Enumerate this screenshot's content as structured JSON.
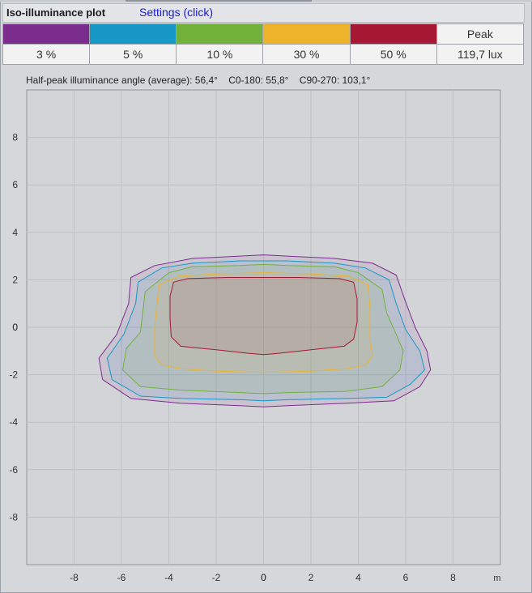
{
  "header": {
    "title": "Iso-illuminance plot",
    "settings_link": "Settings (click)"
  },
  "legend": {
    "levels": [
      {
        "label": "3 %",
        "color": "#7b2d8e"
      },
      {
        "label": "5 %",
        "color": "#1798c6"
      },
      {
        "label": "10 %",
        "color": "#72b23a"
      },
      {
        "label": "30 %",
        "color": "#efb22b"
      },
      {
        "label": "50 %",
        "color": "#a51733"
      }
    ],
    "peak_label": "Peak",
    "peak_value": "119,7 lux"
  },
  "half_peak_text": "Half-peak illuminance angle (average): 56,4°    C0-180: 55,8°    C90-270: 103,1°",
  "chart_data": {
    "type": "contour",
    "x_unit": "m",
    "xlim": [
      -10,
      10
    ],
    "ylim": [
      -10,
      10
    ],
    "x_ticks": [
      -8,
      -6,
      -4,
      -2,
      0,
      2,
      4,
      6,
      8
    ],
    "y_ticks": [
      8,
      6,
      4,
      2,
      0,
      -2,
      -4,
      -6,
      -8
    ],
    "grid": true,
    "series": [
      {
        "name": "3 %",
        "color": "#7b2d8e",
        "points": [
          [
            -5.6,
            2.1
          ],
          [
            -4.6,
            2.6
          ],
          [
            -3,
            2.9
          ],
          [
            -1,
            3.0
          ],
          [
            0,
            3.05
          ],
          [
            1,
            3.0
          ],
          [
            3,
            2.9
          ],
          [
            4.6,
            2.7
          ],
          [
            5.6,
            2.2
          ],
          [
            5.95,
            1.2
          ],
          [
            6.4,
            0.0
          ],
          [
            6.9,
            -1.0
          ],
          [
            7.05,
            -1.8
          ],
          [
            6.6,
            -2.5
          ],
          [
            5.5,
            -3.1
          ],
          [
            3.5,
            -3.2
          ],
          [
            1,
            -3.3
          ],
          [
            0,
            -3.35
          ],
          [
            -1,
            -3.3
          ],
          [
            -3.5,
            -3.2
          ],
          [
            -5.6,
            -3.0
          ],
          [
            -6.8,
            -2.2
          ],
          [
            -6.95,
            -1.3
          ],
          [
            -6.2,
            -0.3
          ],
          [
            -5.7,
            1.0
          ]
        ]
      },
      {
        "name": "5 %",
        "color": "#1798c6",
        "points": [
          [
            -5.3,
            1.9
          ],
          [
            -4.3,
            2.5
          ],
          [
            -3,
            2.7
          ],
          [
            -1,
            2.8
          ],
          [
            0,
            2.8
          ],
          [
            1,
            2.8
          ],
          [
            3,
            2.7
          ],
          [
            4.3,
            2.5
          ],
          [
            5.3,
            2.0
          ],
          [
            5.6,
            1.0
          ],
          [
            6.0,
            -0.1
          ],
          [
            6.6,
            -1.0
          ],
          [
            6.8,
            -1.8
          ],
          [
            6.2,
            -2.4
          ],
          [
            5.2,
            -2.95
          ],
          [
            3.5,
            -3.0
          ],
          [
            1,
            -3.05
          ],
          [
            0,
            -3.1
          ],
          [
            -1,
            -3.05
          ],
          [
            -3.5,
            -3.0
          ],
          [
            -5.2,
            -2.9
          ],
          [
            -6.4,
            -2.2
          ],
          [
            -6.6,
            -1.3
          ],
          [
            -5.9,
            -0.3
          ],
          [
            -5.4,
            1.0
          ]
        ]
      },
      {
        "name": "10 %",
        "color": "#72b23a",
        "points": [
          [
            -5.0,
            1.5
          ],
          [
            -4.0,
            2.3
          ],
          [
            -3,
            2.55
          ],
          [
            -1,
            2.6
          ],
          [
            0,
            2.65
          ],
          [
            1,
            2.6
          ],
          [
            3,
            2.55
          ],
          [
            4.0,
            2.3
          ],
          [
            5.0,
            1.6
          ],
          [
            5.2,
            0.6
          ],
          [
            5.6,
            -0.3
          ],
          [
            5.9,
            -1.0
          ],
          [
            5.75,
            -1.8
          ],
          [
            5.0,
            -2.5
          ],
          [
            3.5,
            -2.7
          ],
          [
            1,
            -2.75
          ],
          [
            0,
            -2.8
          ],
          [
            -1,
            -2.75
          ],
          [
            -3.5,
            -2.65
          ],
          [
            -5.2,
            -2.5
          ],
          [
            -5.95,
            -1.8
          ],
          [
            -5.8,
            -0.9
          ],
          [
            -5.2,
            -0.2
          ]
        ]
      },
      {
        "name": "30 %",
        "color": "#efb22b",
        "points": [
          [
            -4.4,
            1.8
          ],
          [
            -3.6,
            2.15
          ],
          [
            -2,
            2.25
          ],
          [
            0,
            2.3
          ],
          [
            2,
            2.25
          ],
          [
            3.6,
            2.15
          ],
          [
            4.4,
            1.8
          ],
          [
            4.5,
            0.8
          ],
          [
            4.5,
            -0.5
          ],
          [
            4.6,
            -1.2
          ],
          [
            4.3,
            -1.6
          ],
          [
            3.5,
            -1.75
          ],
          [
            2,
            -1.85
          ],
          [
            0,
            -1.9
          ],
          [
            -2,
            -1.85
          ],
          [
            -3.5,
            -1.75
          ],
          [
            -4.3,
            -1.6
          ],
          [
            -4.6,
            -1.2
          ],
          [
            -4.6,
            0.0
          ],
          [
            -4.5,
            1.0
          ]
        ]
      },
      {
        "name": "50 %",
        "color": "#a51733",
        "points": [
          [
            -3.8,
            1.9
          ],
          [
            -3.2,
            2.05
          ],
          [
            -1.5,
            2.1
          ],
          [
            0,
            2.1
          ],
          [
            1.5,
            2.1
          ],
          [
            3.2,
            2.05
          ],
          [
            3.8,
            1.9
          ],
          [
            3.95,
            1.2
          ],
          [
            3.95,
            0.2
          ],
          [
            3.8,
            -0.5
          ],
          [
            3.4,
            -0.8
          ],
          [
            2,
            -0.95
          ],
          [
            0.6,
            -1.1
          ],
          [
            0,
            -1.15
          ],
          [
            -0.6,
            -1.1
          ],
          [
            -2,
            -0.95
          ],
          [
            -3.5,
            -0.8
          ],
          [
            -3.9,
            -0.4
          ],
          [
            -3.95,
            0.4
          ],
          [
            -3.95,
            1.3
          ]
        ]
      }
    ]
  }
}
